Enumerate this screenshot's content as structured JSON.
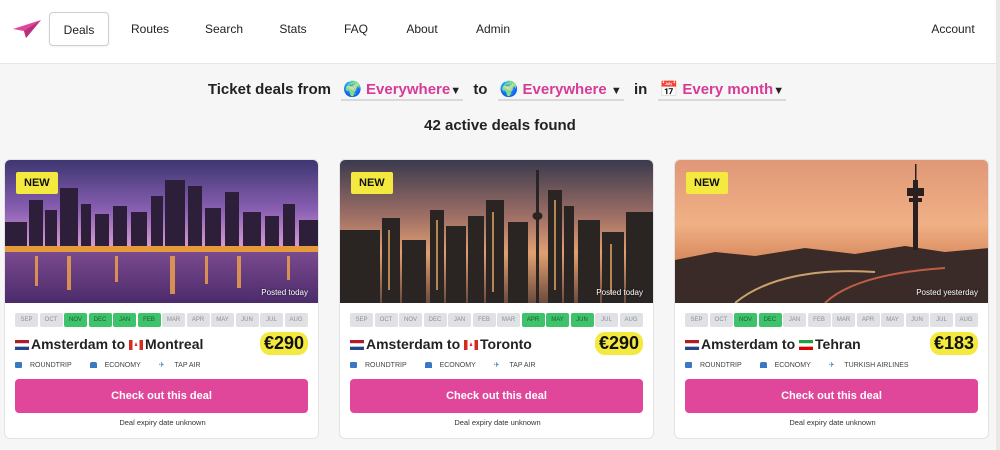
{
  "nav": {
    "items": [
      "Deals",
      "Routes",
      "Search",
      "Stats",
      "FAQ",
      "About",
      "Admin"
    ],
    "account": "Account"
  },
  "filter": {
    "prefix": "Ticket deals from",
    "from": "Everywhere",
    "to_word": "to",
    "to": "Everywhere",
    "in_word": "in",
    "month": "Every month"
  },
  "count": "42 active deals found",
  "months": [
    "SEP",
    "OCT",
    "NOV",
    "DEC",
    "JAN",
    "FEB",
    "MAR",
    "APR",
    "MAY",
    "JUN",
    "JUL",
    "AUG"
  ],
  "colors": {
    "accent": "#e0479a",
    "highlight": "#f4ea3f",
    "month_on": "#3ec36b",
    "month_off": "#dfe1e4"
  },
  "deals": [
    {
      "badge": "NEW",
      "posted": "Posted today",
      "active_months": [
        "NOV",
        "DEC",
        "JAN",
        "FEB"
      ],
      "origin": "Amsterdam",
      "to_word": "to",
      "destination": "Montreal",
      "origin_flag": "netherlands-flag-icon",
      "destination_flag": "canada-flag-icon",
      "price": "€290",
      "trip": "ROUNDTRIP",
      "cabin": "ECONOMY",
      "airline": "TAP AIR",
      "cta": "Check out this deal",
      "expiry": "Deal expiry date unknown"
    },
    {
      "badge": "NEW",
      "posted": "Posted today",
      "active_months": [
        "APR",
        "MAY",
        "JUN"
      ],
      "origin": "Amsterdam",
      "to_word": "to",
      "destination": "Toronto",
      "origin_flag": "netherlands-flag-icon",
      "destination_flag": "canada-flag-icon",
      "price": "€290",
      "trip": "ROUNDTRIP",
      "cabin": "ECONOMY",
      "airline": "TAP AIR",
      "cta": "Check out this deal",
      "expiry": "Deal expiry date unknown"
    },
    {
      "badge": "NEW",
      "posted": "Posted yesterday",
      "active_months": [
        "NOV",
        "DEC"
      ],
      "origin": "Amsterdam",
      "to_word": "to",
      "destination": "Tehran",
      "origin_flag": "netherlands-flag-icon",
      "destination_flag": "iran-flag-icon",
      "price": "€183",
      "trip": "ROUNDTRIP",
      "cabin": "ECONOMY",
      "airline": "TURKISH AIRLINES",
      "cta": "Check out this deal",
      "expiry": "Deal expiry date unknown"
    }
  ]
}
